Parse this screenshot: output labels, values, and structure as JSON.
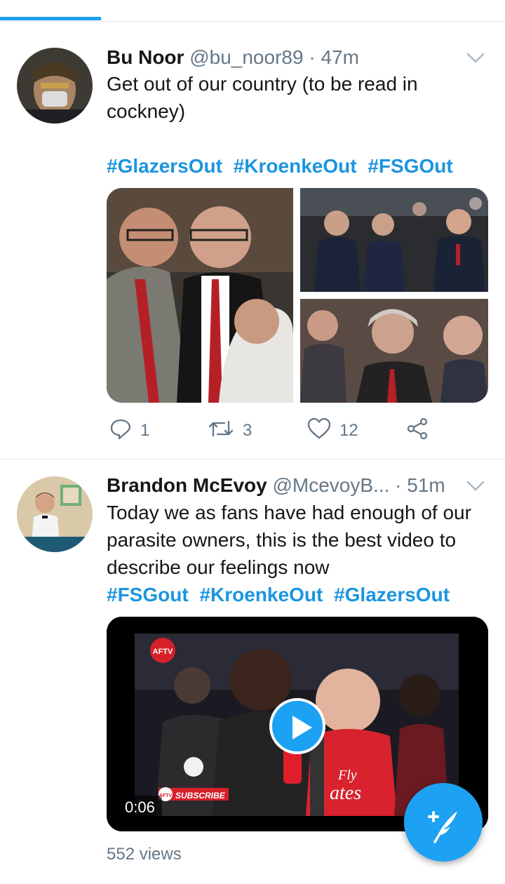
{
  "colors": {
    "accent": "#1da1f2",
    "hashtag": "#1b95e0",
    "muted": "#657786",
    "text": "#14171a"
  },
  "tweets": [
    {
      "name": "Bu Noor",
      "handle": "@bu_noor89",
      "dot": "·",
      "time": "47m",
      "text": "Get out of our country (to be read in cockney)",
      "hashtags": [
        "#GlazersOut",
        "#KroenkeOut",
        "#FSGOut"
      ],
      "replies": "1",
      "retweets": "3",
      "likes": "12"
    },
    {
      "name": "Brandon McEvoy",
      "handle": "@McevoyB...",
      "dot": "·",
      "time": "51m",
      "text": "Today we as fans have had enough of our parasite owners, this is the best video to describe our feelings now",
      "hashtags": [
        "#FSGout",
        "#KroenkeOut",
        "#GlazersOut"
      ],
      "video": {
        "duration": "0:06",
        "channel_badge": "AFTV",
        "shirt_text_1": "Fly",
        "shirt_text_2": "ates",
        "subscribe": "SUBSCRIBE",
        "subscribe_badge": "AFTV"
      },
      "views": "552 views"
    }
  ],
  "icons": {
    "reply": "reply-icon",
    "retweet": "retweet-icon",
    "like": "heart-icon",
    "share": "share-icon",
    "menu": "chevron-down-icon",
    "compose": "compose-tweet-icon"
  }
}
